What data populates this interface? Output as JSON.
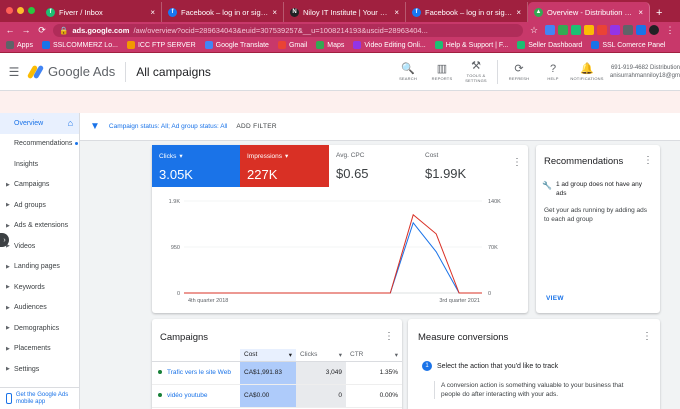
{
  "browser": {
    "tabs": [
      {
        "title": "Fiverr / Inbox",
        "color": "#1dbf73",
        "glyph": "f"
      },
      {
        "title": "Facebook – log in or sign up",
        "color": "#1877f2",
        "glyph": "f"
      },
      {
        "title": "Niloy IT Institute | Your better fu",
        "color": "#202124",
        "glyph": "N"
      },
      {
        "title": "Facebook – log in or sign up",
        "color": "#1877f2",
        "glyph": "f"
      },
      {
        "title": "Overview - Distribution Summ",
        "color": "#34a853",
        "glyph": "▲"
      }
    ],
    "url_domain": "ads.google.com",
    "url_rest": "/aw/overview?ocid=289634043&euid=307539257&__u=1008214193&uscid=28963404...",
    "bookmarks": [
      {
        "label": "Apps",
        "color": "#5f6368"
      },
      {
        "label": "SSLCOMMERZ Lo...",
        "color": "#1a73e8"
      },
      {
        "label": "ICC FTP SERVER",
        "color": "#f29900"
      },
      {
        "label": "Google Translate",
        "color": "#4285f4"
      },
      {
        "label": "Gmail",
        "color": "#ea4335"
      },
      {
        "label": "Maps",
        "color": "#34a853"
      },
      {
        "label": "Video Editing Onli...",
        "color": "#9334e6"
      },
      {
        "label": "Help & Support | F...",
        "color": "#1dbf73"
      },
      {
        "label": "Seller Dashboard",
        "color": "#1dbf73"
      },
      {
        "label": "SSL Comerce Panel",
        "color": "#1a73e8"
      }
    ]
  },
  "header": {
    "product": "Google Ads",
    "page_title": "All campaigns",
    "actions": [
      {
        "label": "SEARCH",
        "icon": "search-icon",
        "glyph": "🔍"
      },
      {
        "label": "REPORTS",
        "icon": "reports-icon",
        "glyph": "▥"
      },
      {
        "label": "TOOLS & SETTINGS",
        "icon": "tools-icon",
        "glyph": "⚒"
      },
      {
        "label": "REFRESH",
        "icon": "refresh-icon",
        "glyph": "⟳"
      },
      {
        "label": "HELP",
        "icon": "help-icon",
        "glyph": "?"
      },
      {
        "label": "NOTIFICATIONS",
        "icon": "bell-icon",
        "glyph": "🔔"
      }
    ],
    "account_id": "691-919-4682 Distribution",
    "account_email": "anisurrahmanniloy18@gm"
  },
  "sidebar": {
    "items": [
      {
        "label": "Overview",
        "active": true,
        "expandable": false
      },
      {
        "label": "Recommendations",
        "active": false,
        "expandable": false,
        "dot": true
      },
      {
        "label": "Insights",
        "active": false,
        "expandable": false
      },
      {
        "label": "Campaigns",
        "active": false,
        "expandable": true
      },
      {
        "label": "Ad groups",
        "active": false,
        "expandable": true
      },
      {
        "label": "Ads & extensions",
        "active": false,
        "expandable": true
      },
      {
        "label": "Videos",
        "active": false,
        "expandable": true
      },
      {
        "label": "Landing pages",
        "active": false,
        "expandable": true
      },
      {
        "label": "Keywords",
        "active": false,
        "expandable": true
      },
      {
        "label": "Audiences",
        "active": false,
        "expandable": true
      },
      {
        "label": "Demographics",
        "active": false,
        "expandable": true
      },
      {
        "label": "Placements",
        "active": false,
        "expandable": true
      },
      {
        "label": "Settings",
        "active": false,
        "expandable": true
      }
    ],
    "mobile_cta": "Get the Google Ads mobile app"
  },
  "filters": {
    "text": "Campaign status: All; Ad group status: All",
    "add_filter": "ADD FILTER"
  },
  "metrics": {
    "clicks": {
      "label": "Clicks",
      "value": "3.05K"
    },
    "impressions": {
      "label": "Impressions",
      "value": "227K"
    },
    "avg_cpc": {
      "label": "Avg. CPC",
      "value": "$0.65"
    },
    "cost": {
      "label": "Cost",
      "value": "$1.99K"
    }
  },
  "chart_data": {
    "type": "line",
    "x": [
      0,
      1,
      2,
      3,
      4,
      5,
      6,
      7,
      8,
      9,
      10,
      11,
      12,
      13
    ],
    "series": [
      {
        "name": "Clicks",
        "color": "#1a73e8",
        "axis": "left",
        "values": [
          0,
          0,
          0,
          0,
          0,
          0,
          0,
          0,
          0,
          0,
          1450,
          850,
          0,
          0
        ]
      },
      {
        "name": "Impressions",
        "color": "#d93025",
        "axis": "right",
        "values": [
          0,
          0,
          0,
          0,
          0,
          0,
          0,
          0,
          0,
          0,
          119000,
          90000,
          0,
          0
        ]
      }
    ],
    "x_tick_labels": [
      "4th quarter 2018",
      "3rd quarter 2021"
    ],
    "left_ticks": [
      "1.9K",
      "950",
      "0"
    ],
    "right_ticks": [
      "140K",
      "70K",
      "0"
    ],
    "left_ylim": [
      0,
      1900
    ],
    "right_ylim": [
      0,
      140000
    ]
  },
  "recommendations": {
    "title": "Recommendations",
    "item": "1 ad group does not have any ads",
    "description": "Get your ads running by adding ads to each ad group",
    "view": "VIEW"
  },
  "campaigns": {
    "title": "Campaigns",
    "columns": [
      "",
      "Cost",
      "Clicks",
      "CTR"
    ],
    "rows": [
      {
        "name": "Trafic vers le site Web",
        "cost": "CA$1,991.83",
        "clicks": "3,049",
        "ctr": "1.35%"
      },
      {
        "name": "vidéo youtube",
        "cost": "CA$0.00",
        "clicks": "0",
        "ctr": "0.00%"
      }
    ]
  },
  "measure": {
    "title": "Measure conversions",
    "step_num": "1",
    "step": "Select the action that you'd like to track",
    "desc": "A conversion action is something valuable to your business that people do after interacting with your ads."
  }
}
